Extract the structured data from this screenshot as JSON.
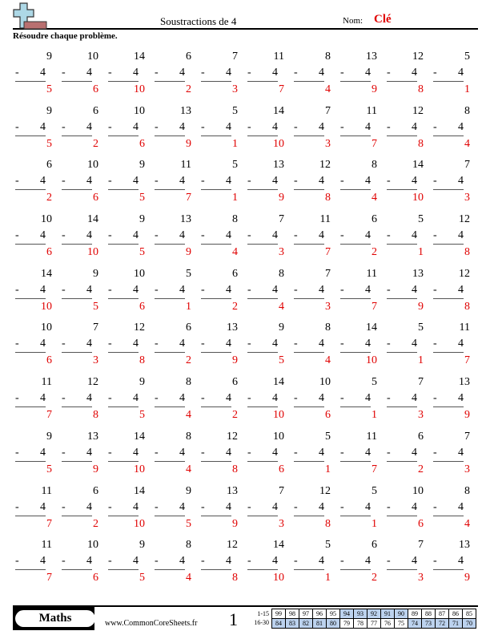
{
  "header": {
    "title": "Soustractions de 4",
    "name_label": "Nom:",
    "name_value": "Clé",
    "logo_icon": "plus-minus-logo-icon"
  },
  "instructions": "Résoudre chaque problème.",
  "operator": "-",
  "subtrahend": "4",
  "problems": [
    [
      {
        "a": "9",
        "ans": "5"
      },
      {
        "a": "10",
        "ans": "6"
      },
      {
        "a": "14",
        "ans": "10"
      },
      {
        "a": "6",
        "ans": "2"
      },
      {
        "a": "7",
        "ans": "3"
      },
      {
        "a": "11",
        "ans": "7"
      },
      {
        "a": "8",
        "ans": "4"
      },
      {
        "a": "13",
        "ans": "9"
      },
      {
        "a": "12",
        "ans": "8"
      },
      {
        "a": "5",
        "ans": "1"
      }
    ],
    [
      {
        "a": "9",
        "ans": "5"
      },
      {
        "a": "6",
        "ans": "2"
      },
      {
        "a": "10",
        "ans": "6"
      },
      {
        "a": "13",
        "ans": "9"
      },
      {
        "a": "5",
        "ans": "1"
      },
      {
        "a": "14",
        "ans": "10"
      },
      {
        "a": "7",
        "ans": "3"
      },
      {
        "a": "11",
        "ans": "7"
      },
      {
        "a": "12",
        "ans": "8"
      },
      {
        "a": "8",
        "ans": "4"
      }
    ],
    [
      {
        "a": "6",
        "ans": "2"
      },
      {
        "a": "10",
        "ans": "6"
      },
      {
        "a": "9",
        "ans": "5"
      },
      {
        "a": "11",
        "ans": "7"
      },
      {
        "a": "5",
        "ans": "1"
      },
      {
        "a": "13",
        "ans": "9"
      },
      {
        "a": "12",
        "ans": "8"
      },
      {
        "a": "8",
        "ans": "4"
      },
      {
        "a": "14",
        "ans": "10"
      },
      {
        "a": "7",
        "ans": "3"
      }
    ],
    [
      {
        "a": "10",
        "ans": "6"
      },
      {
        "a": "14",
        "ans": "10"
      },
      {
        "a": "9",
        "ans": "5"
      },
      {
        "a": "13",
        "ans": "9"
      },
      {
        "a": "8",
        "ans": "4"
      },
      {
        "a": "7",
        "ans": "3"
      },
      {
        "a": "11",
        "ans": "7"
      },
      {
        "a": "6",
        "ans": "2"
      },
      {
        "a": "5",
        "ans": "1"
      },
      {
        "a": "12",
        "ans": "8"
      }
    ],
    [
      {
        "a": "14",
        "ans": "10"
      },
      {
        "a": "9",
        "ans": "5"
      },
      {
        "a": "10",
        "ans": "6"
      },
      {
        "a": "5",
        "ans": "1"
      },
      {
        "a": "6",
        "ans": "2"
      },
      {
        "a": "8",
        "ans": "4"
      },
      {
        "a": "7",
        "ans": "3"
      },
      {
        "a": "11",
        "ans": "7"
      },
      {
        "a": "13",
        "ans": "9"
      },
      {
        "a": "12",
        "ans": "8"
      }
    ],
    [
      {
        "a": "10",
        "ans": "6"
      },
      {
        "a": "7",
        "ans": "3"
      },
      {
        "a": "12",
        "ans": "8"
      },
      {
        "a": "6",
        "ans": "2"
      },
      {
        "a": "13",
        "ans": "9"
      },
      {
        "a": "9",
        "ans": "5"
      },
      {
        "a": "8",
        "ans": "4"
      },
      {
        "a": "14",
        "ans": "10"
      },
      {
        "a": "5",
        "ans": "1"
      },
      {
        "a": "11",
        "ans": "7"
      }
    ],
    [
      {
        "a": "11",
        "ans": "7"
      },
      {
        "a": "12",
        "ans": "8"
      },
      {
        "a": "9",
        "ans": "5"
      },
      {
        "a": "8",
        "ans": "4"
      },
      {
        "a": "6",
        "ans": "2"
      },
      {
        "a": "14",
        "ans": "10"
      },
      {
        "a": "10",
        "ans": "6"
      },
      {
        "a": "5",
        "ans": "1"
      },
      {
        "a": "7",
        "ans": "3"
      },
      {
        "a": "13",
        "ans": "9"
      }
    ],
    [
      {
        "a": "9",
        "ans": "5"
      },
      {
        "a": "13",
        "ans": "9"
      },
      {
        "a": "14",
        "ans": "10"
      },
      {
        "a": "8",
        "ans": "4"
      },
      {
        "a": "12",
        "ans": "8"
      },
      {
        "a": "10",
        "ans": "6"
      },
      {
        "a": "5",
        "ans": "1"
      },
      {
        "a": "11",
        "ans": "7"
      },
      {
        "a": "6",
        "ans": "2"
      },
      {
        "a": "7",
        "ans": "3"
      }
    ],
    [
      {
        "a": "11",
        "ans": "7"
      },
      {
        "a": "6",
        "ans": "2"
      },
      {
        "a": "14",
        "ans": "10"
      },
      {
        "a": "9",
        "ans": "5"
      },
      {
        "a": "13",
        "ans": "9"
      },
      {
        "a": "7",
        "ans": "3"
      },
      {
        "a": "12",
        "ans": "8"
      },
      {
        "a": "5",
        "ans": "1"
      },
      {
        "a": "10",
        "ans": "6"
      },
      {
        "a": "8",
        "ans": "4"
      }
    ],
    [
      {
        "a": "11",
        "ans": "7"
      },
      {
        "a": "10",
        "ans": "6"
      },
      {
        "a": "9",
        "ans": "5"
      },
      {
        "a": "8",
        "ans": "4"
      },
      {
        "a": "12",
        "ans": "8"
      },
      {
        "a": "14",
        "ans": "10"
      },
      {
        "a": "5",
        "ans": "1"
      },
      {
        "a": "6",
        "ans": "2"
      },
      {
        "a": "7",
        "ans": "3"
      },
      {
        "a": "13",
        "ans": "9"
      }
    ]
  ],
  "footer": {
    "subject": "Maths",
    "site": "www.CommonCoreSheets.fr",
    "page": "1",
    "score_rows": [
      {
        "label": "1-15",
        "scores": [
          "99",
          "98",
          "97",
          "96",
          "95",
          "94",
          "93",
          "92",
          "91",
          "90",
          "89",
          "88",
          "87",
          "86",
          "85"
        ],
        "highlight": [
          false,
          false,
          false,
          false,
          false,
          true,
          true,
          true,
          true,
          true,
          false,
          false,
          false,
          false,
          false
        ]
      },
      {
        "label": "16-30",
        "scores": [
          "84",
          "83",
          "82",
          "81",
          "80",
          "79",
          "78",
          "77",
          "76",
          "75",
          "74",
          "73",
          "72",
          "71",
          "70"
        ],
        "highlight": [
          true,
          true,
          true,
          true,
          true,
          false,
          false,
          false,
          false,
          false,
          true,
          true,
          true,
          true,
          true
        ]
      }
    ]
  },
  "colors": {
    "answer": "#e00000",
    "score_highlight": "#bcd2ee"
  }
}
